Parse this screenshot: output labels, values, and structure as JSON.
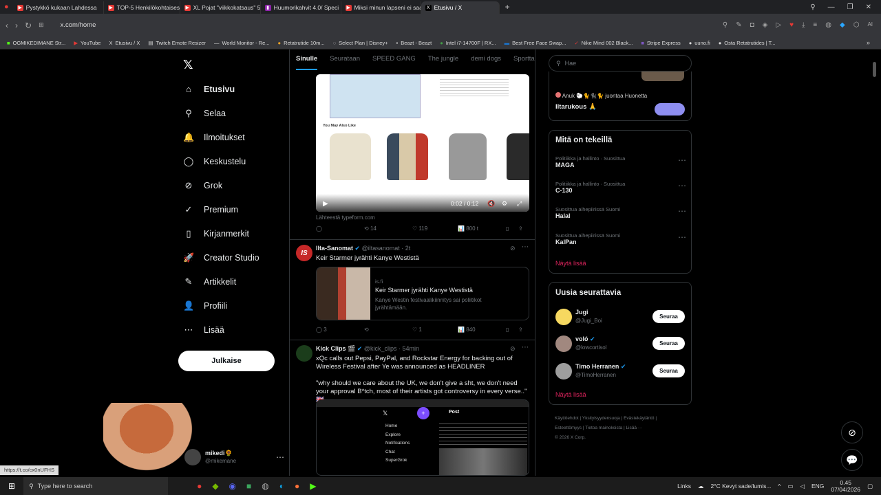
{
  "tabs": [
    {
      "label": "Pystykkö kukaan Lahdessa",
      "color": "#e53935"
    },
    {
      "label": "TOP-5 Henkilökohtaisesti",
      "color": "#e53935"
    },
    {
      "label": "XL Pojat \"viikkokatsaus\" 5",
      "color": "#e53935"
    },
    {
      "label": "Huumorikahvit 4.0/ Speci",
      "color": "#8e24aa"
    },
    {
      "label": "Miksi minun lapseni ei saa",
      "color": "#e53935"
    },
    {
      "label": "Etusivu / X",
      "color": "#000000"
    }
  ],
  "url": "x.com/home",
  "bookmarks": [
    "OGMIKEDIMANE Str...",
    "YouTube",
    "Etusivu / X",
    "Twitch Emote Resizer",
    "World Monitor - Re...",
    "Retatrutide 10m...",
    "Select Plan | Disney+",
    "Beazt - Beazt",
    "Intel i7-14700F | RX...",
    "Best Free Face Swap...",
    "Nike Mind 002 Black...",
    "Stripe Express",
    "uuno.fi",
    "Osta Retatrutides | T..."
  ],
  "sidebar": {
    "items": [
      {
        "label": "Etusivu",
        "icon": "⌂"
      },
      {
        "label": "Selaa",
        "icon": "⚲"
      },
      {
        "label": "Ilmoitukset",
        "icon": "🔔"
      },
      {
        "label": "Keskustelu",
        "icon": "◯"
      },
      {
        "label": "Grok",
        "icon": "⊘"
      },
      {
        "label": "Premium",
        "icon": "✓"
      },
      {
        "label": "Kirjanmerkit",
        "icon": "▯"
      },
      {
        "label": "Creator Studio",
        "icon": "🚀"
      },
      {
        "label": "Artikkelit",
        "icon": "✎"
      },
      {
        "label": "Profiili",
        "icon": "👤"
      },
      {
        "label": "Lisää",
        "icon": "⋯"
      }
    ],
    "post_label": "Julkaise",
    "account_name": "mikedi🌻",
    "account_handle": "@mikemane"
  },
  "feed": {
    "tabs": [
      "Sinulle",
      "Seurataan",
      "SPEED GANG",
      "The jungle",
      "demi dogs",
      "Sportta S"
    ],
    "t1": {
      "you_may_also_like": "You May Also Like",
      "video_time": "0:02 / 0:12",
      "source": "Lähteestä typeform.com",
      "retweets": "14",
      "likes": "119",
      "views": "800 t"
    },
    "t2": {
      "name": "Ilta-Sanomat",
      "handle": "@iltasanomat · 2t",
      "text": "Keir Starmer jyrähti Kanye Westistä",
      "card_domain": "is.fi",
      "card_title": "Keir Starmer jyrähti Kanye Westistä",
      "card_desc": "Kanye Westin festivaalikiinnitys sai poliitikot jyrähtämään.",
      "replies": "3",
      "likes": "1",
      "views": "840"
    },
    "t3": {
      "name": "Kick Clips 🎬",
      "handle": "@kick_clips · 54min",
      "text": "xQc calls out Pepsi, PayPal, and Rockstar Energy for backing out of Wireless Festival after Ye was announced as HEADLINER",
      "quote": "\"why should we care about the UK, we don't give a sht, we don't need your approval B*tch, most of their artists got controversy in every verse..\" 🇬🇧",
      "menu": [
        "Home",
        "Explore",
        "Notifications",
        "Chat",
        "SuperGrok"
      ],
      "post_label": "Post"
    }
  },
  "right": {
    "search_placeholder": "Hae",
    "space_line": "Anuk 🐑🐈🐈‍⬛🐈 juontaa Huonetta",
    "space_title": "Iltarukous 🙏",
    "trends_title": "Mitä on tekeillä",
    "trends": [
      {
        "cat": "Politiikka ja hallinto · Suosittua",
        "name": "MAGA"
      },
      {
        "cat": "Politiikka ja hallinto · Suosittua",
        "name": "C-130"
      },
      {
        "cat": "Suosittua aihepiirissä Suomi",
        "name": "Halal"
      },
      {
        "cat": "Suosittua aihepiirissä Suomi",
        "name": "KalPan"
      }
    ],
    "show_more": "Näytä lisää",
    "follow_title": "Uusia seurattavia",
    "follow": [
      {
        "name": "Jugi",
        "handle": "@Jugi_Boi",
        "btn": "Seuraa"
      },
      {
        "name": "voló",
        "handle": "@lowcortisol",
        "btn": "Seuraa"
      },
      {
        "name": "Timo Herranen",
        "handle": "@TimoHerranen",
        "btn": "Seuraa"
      }
    ],
    "footer1": "Käyttöehdot  |  Yksityisyydensuoja  |  Evästekäytäntö  |",
    "footer2": "Esteettömyys  |  Tietoa mainoksista  |  Lisää ···",
    "footer3": "© 2026 X Corp."
  },
  "status_url": "https://t.co/cx0nUFHS",
  "taskbar": {
    "search": "Type here to search",
    "links": "Links",
    "weather": "2°C  Kevyt sade/lumis...",
    "lang": "ENG",
    "time": "0.45",
    "date": "07/04/2026"
  }
}
